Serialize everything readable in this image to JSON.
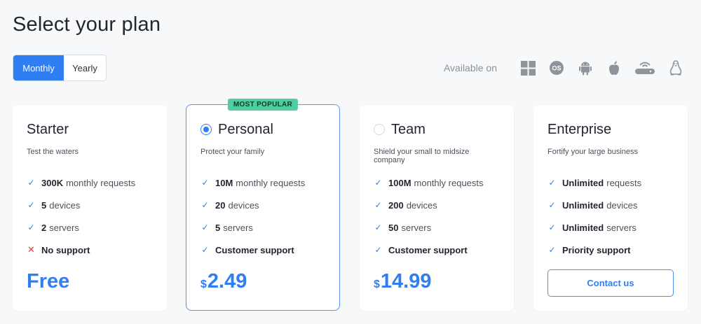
{
  "page": {
    "title": "Select your plan"
  },
  "billing_toggle": {
    "options": [
      "Monthly",
      "Yearly"
    ],
    "selected": "Monthly"
  },
  "availability": {
    "label": "Available on",
    "platforms": [
      "windows-icon",
      "macos-icon",
      "android-icon",
      "apple-icon",
      "router-icon",
      "linux-icon"
    ]
  },
  "plans": [
    {
      "name": "Starter",
      "subtitle": "Test the waters",
      "features": [
        {
          "icon": "check",
          "strong": "300K",
          "rest": "monthly requests"
        },
        {
          "icon": "check",
          "strong": "5",
          "rest": "devices"
        },
        {
          "icon": "check",
          "strong": "2",
          "rest": "servers"
        },
        {
          "icon": "cross",
          "strong": "No support",
          "rest": ""
        }
      ],
      "price": {
        "currency": "",
        "amount": "Free"
      }
    },
    {
      "name": "Personal",
      "badge": "MOST POPULAR",
      "selected": true,
      "subtitle": "Protect your family",
      "features": [
        {
          "icon": "check",
          "strong": "10M",
          "rest": "monthly requests"
        },
        {
          "icon": "check",
          "strong": "20",
          "rest": "devices"
        },
        {
          "icon": "check",
          "strong": "5",
          "rest": "servers"
        },
        {
          "icon": "check",
          "strong": "Customer support",
          "rest": ""
        }
      ],
      "price": {
        "currency": "$",
        "amount": "2.49"
      }
    },
    {
      "name": "Team",
      "selected": false,
      "subtitle": "Shield your small to midsize company",
      "features": [
        {
          "icon": "check",
          "strong": "100M",
          "rest": "monthly requests"
        },
        {
          "icon": "check",
          "strong": "200",
          "rest": "devices"
        },
        {
          "icon": "check",
          "strong": "50",
          "rest": "servers"
        },
        {
          "icon": "check",
          "strong": "Customer support",
          "rest": ""
        }
      ],
      "price": {
        "currency": "$",
        "amount": "14.99"
      }
    },
    {
      "name": "Enterprise",
      "subtitle": "Fortify your large business",
      "features": [
        {
          "icon": "check",
          "strong": "Unlimited",
          "rest": "requests"
        },
        {
          "icon": "check",
          "strong": "Unlimited",
          "rest": "devices"
        },
        {
          "icon": "check",
          "strong": "Unlimited",
          "rest": "servers"
        },
        {
          "icon": "check",
          "strong": "Priority support",
          "rest": ""
        }
      ],
      "cta": "Contact us"
    }
  ],
  "colors": {
    "accent": "#2f7ef2",
    "badge": "#4fcf9f",
    "cross": "#e0413b"
  }
}
